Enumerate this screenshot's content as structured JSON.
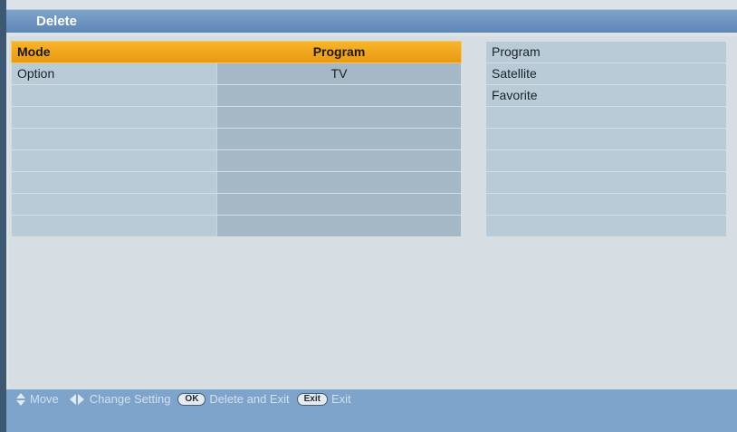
{
  "window": {
    "title": "Delete"
  },
  "table": {
    "rows": [
      {
        "label": "Mode",
        "value": "Program",
        "highlighted": true
      },
      {
        "label": "Option",
        "value": "TV",
        "highlighted": false
      },
      {
        "label": "",
        "value": ""
      },
      {
        "label": "",
        "value": ""
      },
      {
        "label": "",
        "value": ""
      },
      {
        "label": "",
        "value": ""
      },
      {
        "label": "",
        "value": ""
      },
      {
        "label": "",
        "value": ""
      },
      {
        "label": "",
        "value": ""
      }
    ]
  },
  "options_list": {
    "items": [
      "Program",
      "Satellite",
      "Favorite",
      "",
      "",
      "",
      "",
      "",
      ""
    ]
  },
  "footer": {
    "move_label": "Move",
    "change_label": "Change Setting",
    "ok_key": "OK",
    "ok_label": "Delete and Exit",
    "exit_key": "Exit",
    "exit_label": "Exit"
  },
  "colors": {
    "highlight": "#f0a81d",
    "title_bar": "#6e95c0",
    "cell": "#b9cbd6"
  }
}
